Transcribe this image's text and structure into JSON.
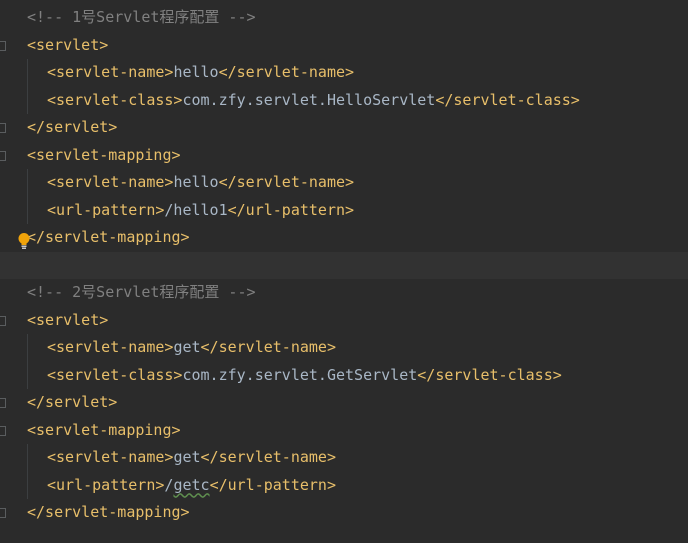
{
  "block1": {
    "comment": "<!-- 1号Servlet程序配置 -->",
    "servlet_open": "<servlet>",
    "name_open": "<servlet-name>",
    "name_value": "hello",
    "name_close": "</servlet-name>",
    "class_open": "<servlet-class>",
    "class_value": "com.zfy.servlet.HelloServlet",
    "class_close": "</servlet-class>",
    "servlet_close": "</servlet>",
    "mapping_open": "<servlet-mapping>",
    "map_name_open": "<servlet-name>",
    "map_name_value": "hello",
    "map_name_close": "</servlet-name>",
    "url_open": "<url-pattern>",
    "url_value": "/hello1",
    "url_close": "</url-pattern>",
    "mapping_close": "</servlet-mapping>"
  },
  "block2": {
    "comment": "<!-- 2号Servlet程序配置 -->",
    "servlet_open": "<servlet>",
    "name_open": "<servlet-name>",
    "name_value": "get",
    "name_close": "</servlet-name>",
    "class_open": "<servlet-class>",
    "class_value": "com.zfy.servlet.GetServlet",
    "class_close": "</servlet-class>",
    "servlet_close": "</servlet>",
    "mapping_open": "<servlet-mapping>",
    "map_name_open": "<servlet-name>",
    "map_name_value": "get",
    "map_name_close": "</servlet-name>",
    "url_open": "<url-pattern>",
    "url_slash": "/",
    "url_value": "getc",
    "url_close": "</url-pattern>",
    "mapping_close": "</servlet-mapping>"
  },
  "icons": {
    "intention": "lightbulb-icon",
    "fold": "fold-marker-icon"
  },
  "colors": {
    "background": "#2b2b2b",
    "current_line": "#323232",
    "tag": "#e8bf6a",
    "text": "#a9b7c6",
    "comment": "#808080",
    "bulb": "#f0a30a"
  }
}
